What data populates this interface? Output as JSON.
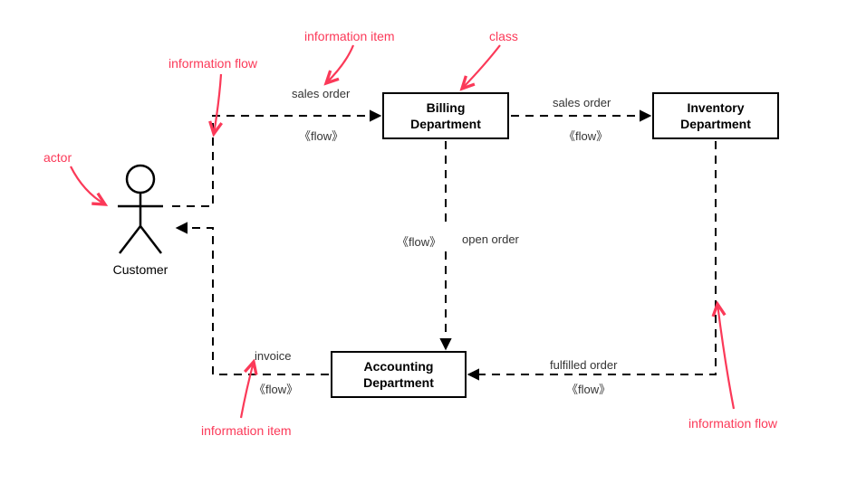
{
  "actor": {
    "label": "Customer"
  },
  "classes": {
    "billing": {
      "label": "Billing\nDepartment"
    },
    "inventory": {
      "label": "Inventory\nDepartment"
    },
    "accounting": {
      "label": "Accounting\nDepartment"
    }
  },
  "flows": {
    "cust_to_billing": {
      "item": "sales order",
      "stereo": "《flow》"
    },
    "billing_to_inv": {
      "item": "sales order",
      "stereo": "《flow》"
    },
    "billing_to_acct": {
      "item": "open order",
      "stereo": "《flow》"
    },
    "inv_to_acct": {
      "item": "fulfilled order",
      "stereo": "《flow》"
    },
    "acct_to_cust": {
      "item": "invoice",
      "stereo": "《flow》"
    }
  },
  "annotations": {
    "actor": "actor",
    "info_flow_top": "information flow",
    "info_item_top": "information item",
    "class": "class",
    "info_item_bot": "information item",
    "info_flow_right": "information flow"
  }
}
